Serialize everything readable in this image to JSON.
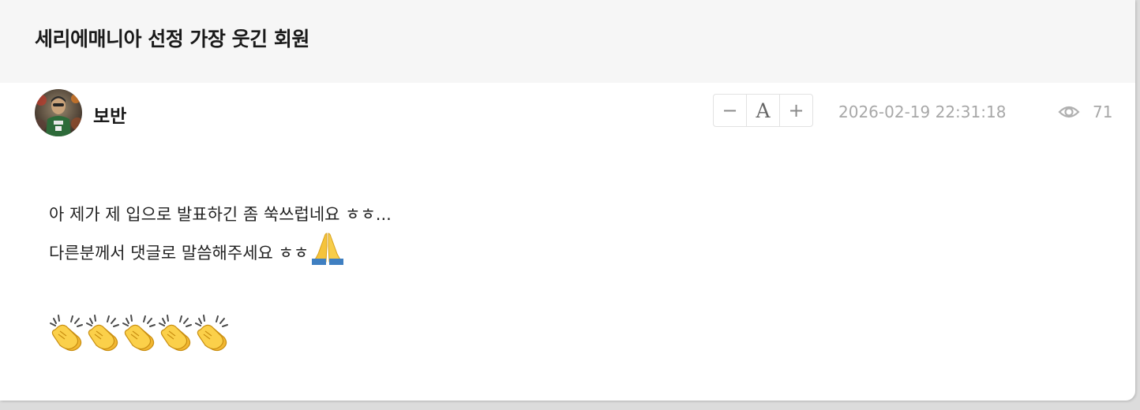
{
  "post": {
    "title": "세리에매니아 선정 가장 웃긴 회원",
    "author": "보반",
    "datetime": "2026-02-19 22:31:18",
    "views": "71",
    "body_lines": [
      "아 제가 제 입으로 발표하긴 좀 쑥쓰럽네요 ㅎㅎ...",
      "다른분께서 댓글로 말씀해주세요 ㅎㅎ"
    ],
    "clap_count": 5
  },
  "font_controls": {
    "decrease_label": "−",
    "font_label": "A",
    "increase_label": "+"
  },
  "icons": {
    "views": "eye-icon",
    "pray": "folded-hands-emoji",
    "clap": "clapping-hands-emoji"
  },
  "colors": {
    "title_bar_bg": "#f6f6f6",
    "meta_text": "#a8a8a8",
    "body_text": "#222222"
  }
}
